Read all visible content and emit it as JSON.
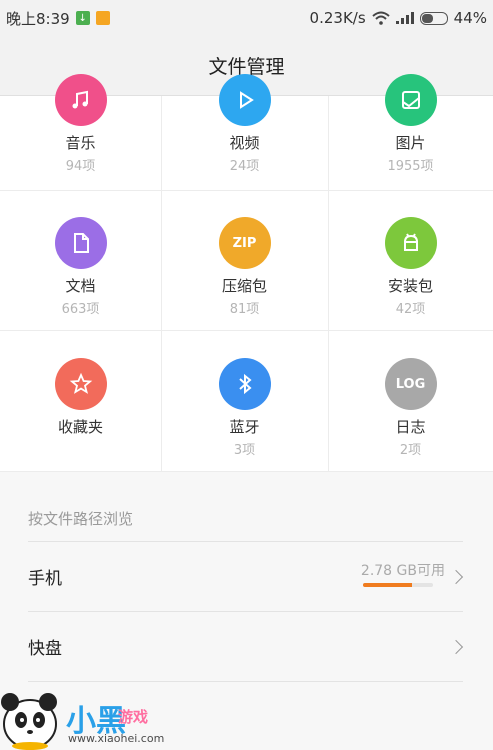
{
  "status_bar": {
    "time": "晚上8:39",
    "speed": "0.23K/s",
    "battery": "44%",
    "battery_level": 0.44,
    "icons": [
      "download-icon",
      "note-icon",
      "wifi-icon",
      "signal-icon",
      "battery-icon"
    ]
  },
  "header": {
    "title": "文件管理"
  },
  "categories": [
    {
      "label": "音乐",
      "count": "94项",
      "icon": "music-icon",
      "color": "#f0508a"
    },
    {
      "label": "视频",
      "count": "24项",
      "icon": "play-icon",
      "color": "#2da7f0"
    },
    {
      "label": "图片",
      "count": "1955项",
      "icon": "image-icon",
      "color": "#27c47c"
    },
    {
      "label": "文档",
      "count": "663项",
      "icon": "document-icon",
      "color": "#9b6ee6",
      "badge": ""
    },
    {
      "label": "压缩包",
      "count": "81项",
      "icon": "zip-icon",
      "color": "#f0a92a",
      "badge": "ZIP"
    },
    {
      "label": "安装包",
      "count": "42项",
      "icon": "android-icon",
      "color": "#7dc83c",
      "badge": ""
    },
    {
      "label": "收藏夹",
      "count": "",
      "icon": "star-icon",
      "color": "#f26b5b",
      "badge": ""
    },
    {
      "label": "蓝牙",
      "count": "3项",
      "icon": "bluetooth-icon",
      "color": "#3a8ff0",
      "badge": ""
    },
    {
      "label": "日志",
      "count": "2项",
      "icon": "log-icon",
      "color": "#a8a8a8",
      "badge": "LOG"
    }
  ],
  "browse": {
    "title": "按文件路径浏览",
    "phone_label": "手机",
    "phone_storage": "2.78 GB可用",
    "phone_storage_used_fraction": 0.7,
    "kuaipan_label": "快盘"
  },
  "watermark": {
    "logo_text": "小黑",
    "logo_sub": "游戏",
    "url": "www.xiaohei.com"
  }
}
